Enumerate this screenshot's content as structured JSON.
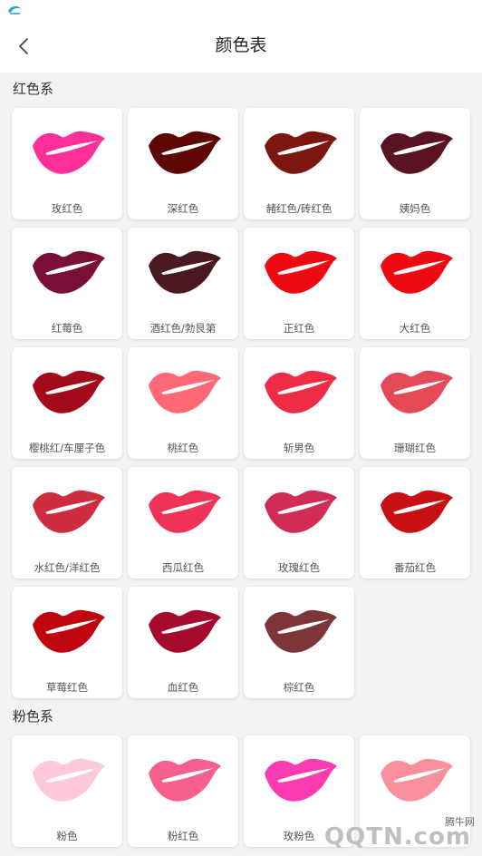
{
  "header": {
    "title": "颜色表",
    "back_icon": "chevron-left-icon"
  },
  "status_icon": "app-notification-icon",
  "sections": [
    {
      "title": "红色系",
      "colors": [
        {
          "name": "玫红色",
          "hex": "#ff2f9a"
        },
        {
          "name": "深红色",
          "hex": "#5e0506"
        },
        {
          "name": "赭红色/砖红色",
          "hex": "#7c1710"
        },
        {
          "name": "姨妈色",
          "hex": "#5a1321"
        },
        {
          "name": "红莓色",
          "hex": "#780f36"
        },
        {
          "name": "酒红色/勃艮第",
          "hex": "#491820"
        },
        {
          "name": "正红色",
          "hex": "#ee0a12"
        },
        {
          "name": "大红色",
          "hex": "#ee0a12"
        },
        {
          "name": "樱桃红/车厘子色",
          "hex": "#a30b1d"
        },
        {
          "name": "桃红色",
          "hex": "#ff6975"
        },
        {
          "name": "斩男色",
          "hex": "#ee2d45"
        },
        {
          "name": "珊瑚红色",
          "hex": "#e34a55"
        },
        {
          "name": "水红色/洋红色",
          "hex": "#ce2c3f"
        },
        {
          "name": "西瓜红色",
          "hex": "#ef3258"
        },
        {
          "name": "玫瑰红色",
          "hex": "#d02d56"
        },
        {
          "name": "番茄红色",
          "hex": "#c61012"
        },
        {
          "name": "草莓红色",
          "hex": "#c00410"
        },
        {
          "name": "血红色",
          "hex": "#a5092c"
        },
        {
          "name": "棕红色",
          "hex": "#7d3637"
        }
      ]
    },
    {
      "title": "粉色系",
      "colors": [
        {
          "name": "粉色",
          "hex": "#ffc9dc"
        },
        {
          "name": "粉红色",
          "hex": "#f5608f"
        },
        {
          "name": "玫粉色",
          "hex": "#fb3cb0"
        },
        {
          "name": "",
          "hex": "#f7909c"
        }
      ]
    }
  ],
  "watermark": {
    "site": "腾牛网",
    "logo": "QQTN.com"
  }
}
